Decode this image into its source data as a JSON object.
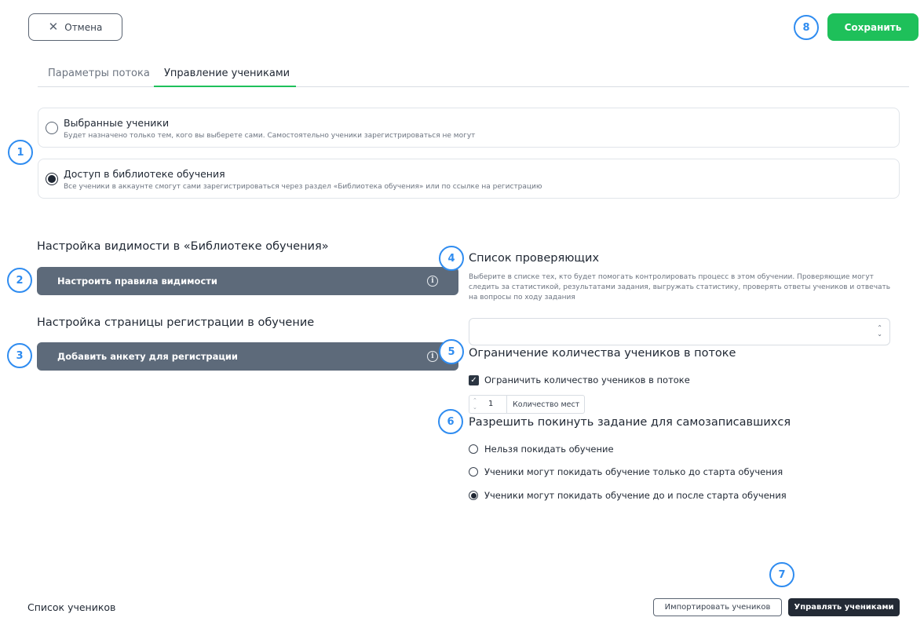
{
  "header": {
    "cancel_label": "Отмена",
    "save_label": "Сохранить"
  },
  "tabs": [
    {
      "label": "Параметры потока",
      "active": false
    },
    {
      "label": "Управление учениками",
      "active": true
    }
  ],
  "access": {
    "options": [
      {
        "title": "Выбранные ученики",
        "description": "Будет назначено только тем, кого вы выберете сами. Самостоятельно ученики зарегистрироваться не могут",
        "selected": false
      },
      {
        "title": "Доступ в библиотеке обучения",
        "description": "Все ученики в аккаунте смогут сами зарегистрироваться через раздел «Библиотека обучения» или по ссылке на регистрацию",
        "selected": true
      }
    ]
  },
  "visibility": {
    "heading": "Настройка видимости в «Библиотеке обучения»",
    "button_label": "Настроить правила видимости"
  },
  "registration": {
    "heading": "Настройка страницы регистрации в обучение",
    "button_label": "Добавить анкету для регистрации"
  },
  "reviewers": {
    "heading": "Список проверяющих",
    "description": "Выберите в списке тех, кто будет помогать контролировать процесс в этом обучении. Проверяющие могут следить за статистикой, результатами задания, выгружать статистику, проверять ответы учеников и отвечать на вопросы по ходу задания",
    "select_value": ""
  },
  "limit": {
    "heading": "Ограничение количества учеников в потоке",
    "checkbox_label": "Ограничить количество учеников в потоке",
    "checked": true,
    "seats_value": "1",
    "seats_label": "Количество мест"
  },
  "leave": {
    "heading": "Разрешить покинуть задание для самозаписавшихся",
    "options": [
      {
        "label": "Нельзя покидать обучение",
        "selected": false
      },
      {
        "label": "Ученики могут покидать обучение только до старта обучения",
        "selected": false
      },
      {
        "label": "Ученики могут покидать обучение до и после старта обучения",
        "selected": true
      }
    ]
  },
  "footer": {
    "title": "Список учеников",
    "import_label": "Импортировать учеников",
    "manage_label": "Управлять учениками"
  },
  "badges": [
    "1",
    "2",
    "3",
    "4",
    "5",
    "6",
    "7",
    "8"
  ],
  "colors": {
    "accent_green": "#1ec05a",
    "badge_blue": "#2f8cf0",
    "dark_button": "#5d6a7a",
    "primary_dark": "#232a35"
  }
}
